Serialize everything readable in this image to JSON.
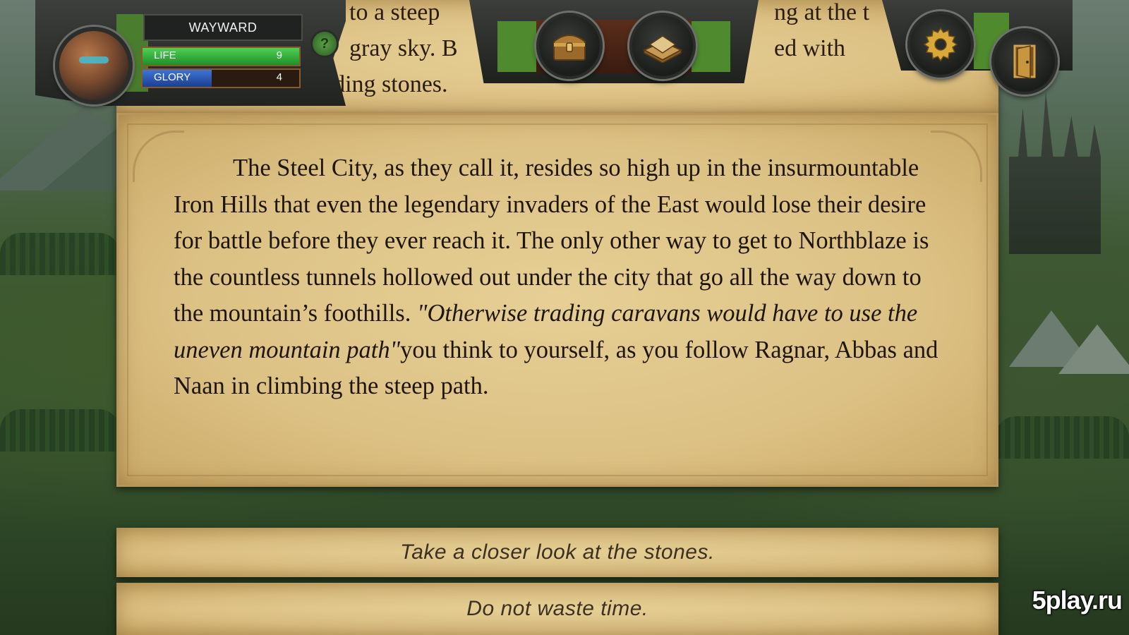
{
  "player": {
    "name": "WAYWARD",
    "life_label": "LIFE",
    "life_value": "9",
    "life_fraction": 1.0,
    "glory_label": "GLORY",
    "glory_value": "4",
    "glory_fraction": 0.44,
    "help_label": "?"
  },
  "previous_text": {
    "line1_a": "to a steep",
    "line1_b": "ng at the t",
    "line2_a": "gray sky. B",
    "line2_b": "ed with",
    "line3_a": "anding stones."
  },
  "story": {
    "part1": "The Steel City, as they call it, resides so high up in the insurmountable Iron Hills that even the legendary invaders of the East would lose their desire for battle before they ever reach it. The only other way to get to Northblaze is the countless tunnels hollowed out under the city that go all the way down to the mountain’s foothills.",
    "quote": "\"Otherwise trading caravans would have to use the uneven mountain path\"",
    "part2": "you think to yourself, as you follow Ragnar, Abbas and Naan in climbing the steep path."
  },
  "choices": [
    {
      "label": "Take a closer look at the stones."
    },
    {
      "label": "Do not waste time."
    }
  ],
  "toolbar": {
    "chest_icon": "treasure-chest-icon",
    "book_icon": "book-icon",
    "settings_icon": "gear-icon",
    "exit_icon": "door-exit-icon"
  },
  "colors": {
    "life_bar": "#2fb238",
    "glory_bar": "#2a56b8",
    "parchment": "#dcc184",
    "frame_green": "#4f8a2e"
  },
  "watermark": "5play.ru"
}
